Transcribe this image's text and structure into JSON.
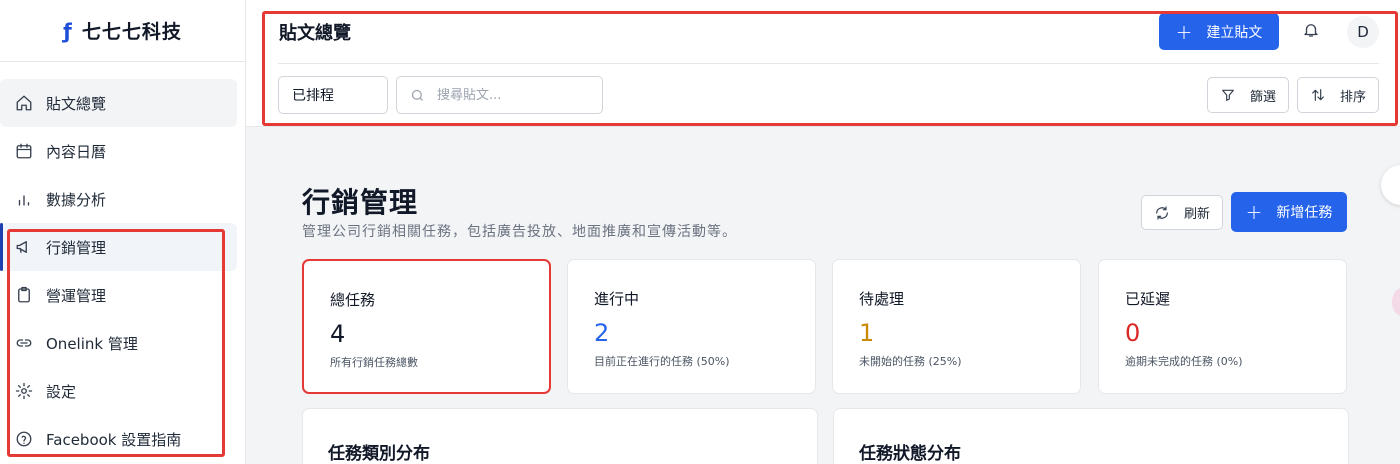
{
  "brand": {
    "logo_icon": "facebook-icon",
    "name": "七七七科技"
  },
  "sidebar": {
    "items": [
      {
        "label": "貼文總覽",
        "icon": "home-icon"
      },
      {
        "label": "內容日曆",
        "icon": "calendar-icon"
      },
      {
        "label": "數據分析",
        "icon": "bar-chart-icon"
      },
      {
        "label": "行銷管理",
        "icon": "megaphone-icon"
      },
      {
        "label": "營運管理",
        "icon": "clipboard-icon"
      },
      {
        "label": "Onelink 管理",
        "icon": "link-icon"
      },
      {
        "label": "設定",
        "icon": "gear-icon"
      },
      {
        "label": "Facebook 設置指南",
        "icon": "help-circle-icon"
      }
    ]
  },
  "header": {
    "title": "貼文總覽",
    "create_label": "建立貼文",
    "avatar_initial": "D",
    "filter_select": "已排程",
    "search_placeholder": "搜尋貼文...",
    "filter_label": "篩選",
    "sort_label": "排序"
  },
  "main": {
    "title": "行銷管理",
    "subtitle": "管理公司行銷相關任務，包括廣告投放、地面推廣和宣傳活動等。",
    "refresh_label": "刷新",
    "new_task_label": "新增任務",
    "stats": [
      {
        "label": "總任務",
        "value": "4",
        "desc": "所有行銷任務總數",
        "color": "#111827"
      },
      {
        "label": "進行中",
        "value": "2",
        "desc": "目前正在進行的任務 (50%)",
        "color": "#2563eb"
      },
      {
        "label": "待處理",
        "value": "1",
        "desc": "未開始的任務 (25%)",
        "color": "#ca8a04"
      },
      {
        "label": "已延遲",
        "value": "0",
        "desc": "逾期未完成的任務 (0%)",
        "color": "#dc2626"
      }
    ],
    "panels": [
      {
        "title": "任務類別分布"
      },
      {
        "title": "任務狀態分布"
      }
    ]
  },
  "colors": {
    "accent": "#2563eb",
    "highlight": "#e53935"
  }
}
